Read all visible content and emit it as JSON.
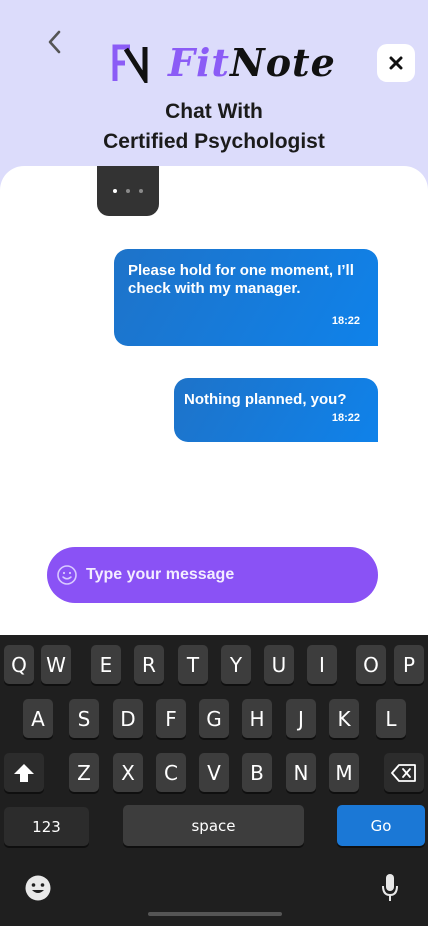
{
  "header": {
    "logo_part1": "Fit",
    "logo_part2": "Note",
    "title_line1": "Chat With",
    "title_line2": "Certified Psychologist"
  },
  "chat": {
    "messages": [
      {
        "text": "Please hold for one moment, I’ll check with my manager.",
        "time": "18:22"
      },
      {
        "text": "Nothing planned, you?",
        "time": "18:22"
      }
    ]
  },
  "composer": {
    "placeholder": "Type your message"
  },
  "keyboard": {
    "row1": [
      "Q",
      "W",
      "E",
      "R",
      "T",
      "Y",
      "U",
      "I",
      "O",
      "P"
    ],
    "row2": [
      "A",
      "S",
      "D",
      "F",
      "G",
      "H",
      "J",
      "K",
      "L"
    ],
    "row3": [
      "Z",
      "X",
      "C",
      "V",
      "B",
      "N",
      "M"
    ],
    "numbers_label": "123",
    "space_label": "space",
    "go_label": "Go"
  },
  "colors": {
    "header_bg": "#dcdcfb",
    "brand_purple": "#8b5cf6",
    "bubble_blue": "#0f82ea",
    "composer_purple": "#8a52f5",
    "keyboard_bg": "#1f1f1f",
    "go_blue": "#1b78d6"
  },
  "icons": [
    "back-chevron-icon",
    "close-icon",
    "typing-indicator",
    "emoji-icon",
    "shift-icon",
    "backspace-icon",
    "mic-icon"
  ]
}
